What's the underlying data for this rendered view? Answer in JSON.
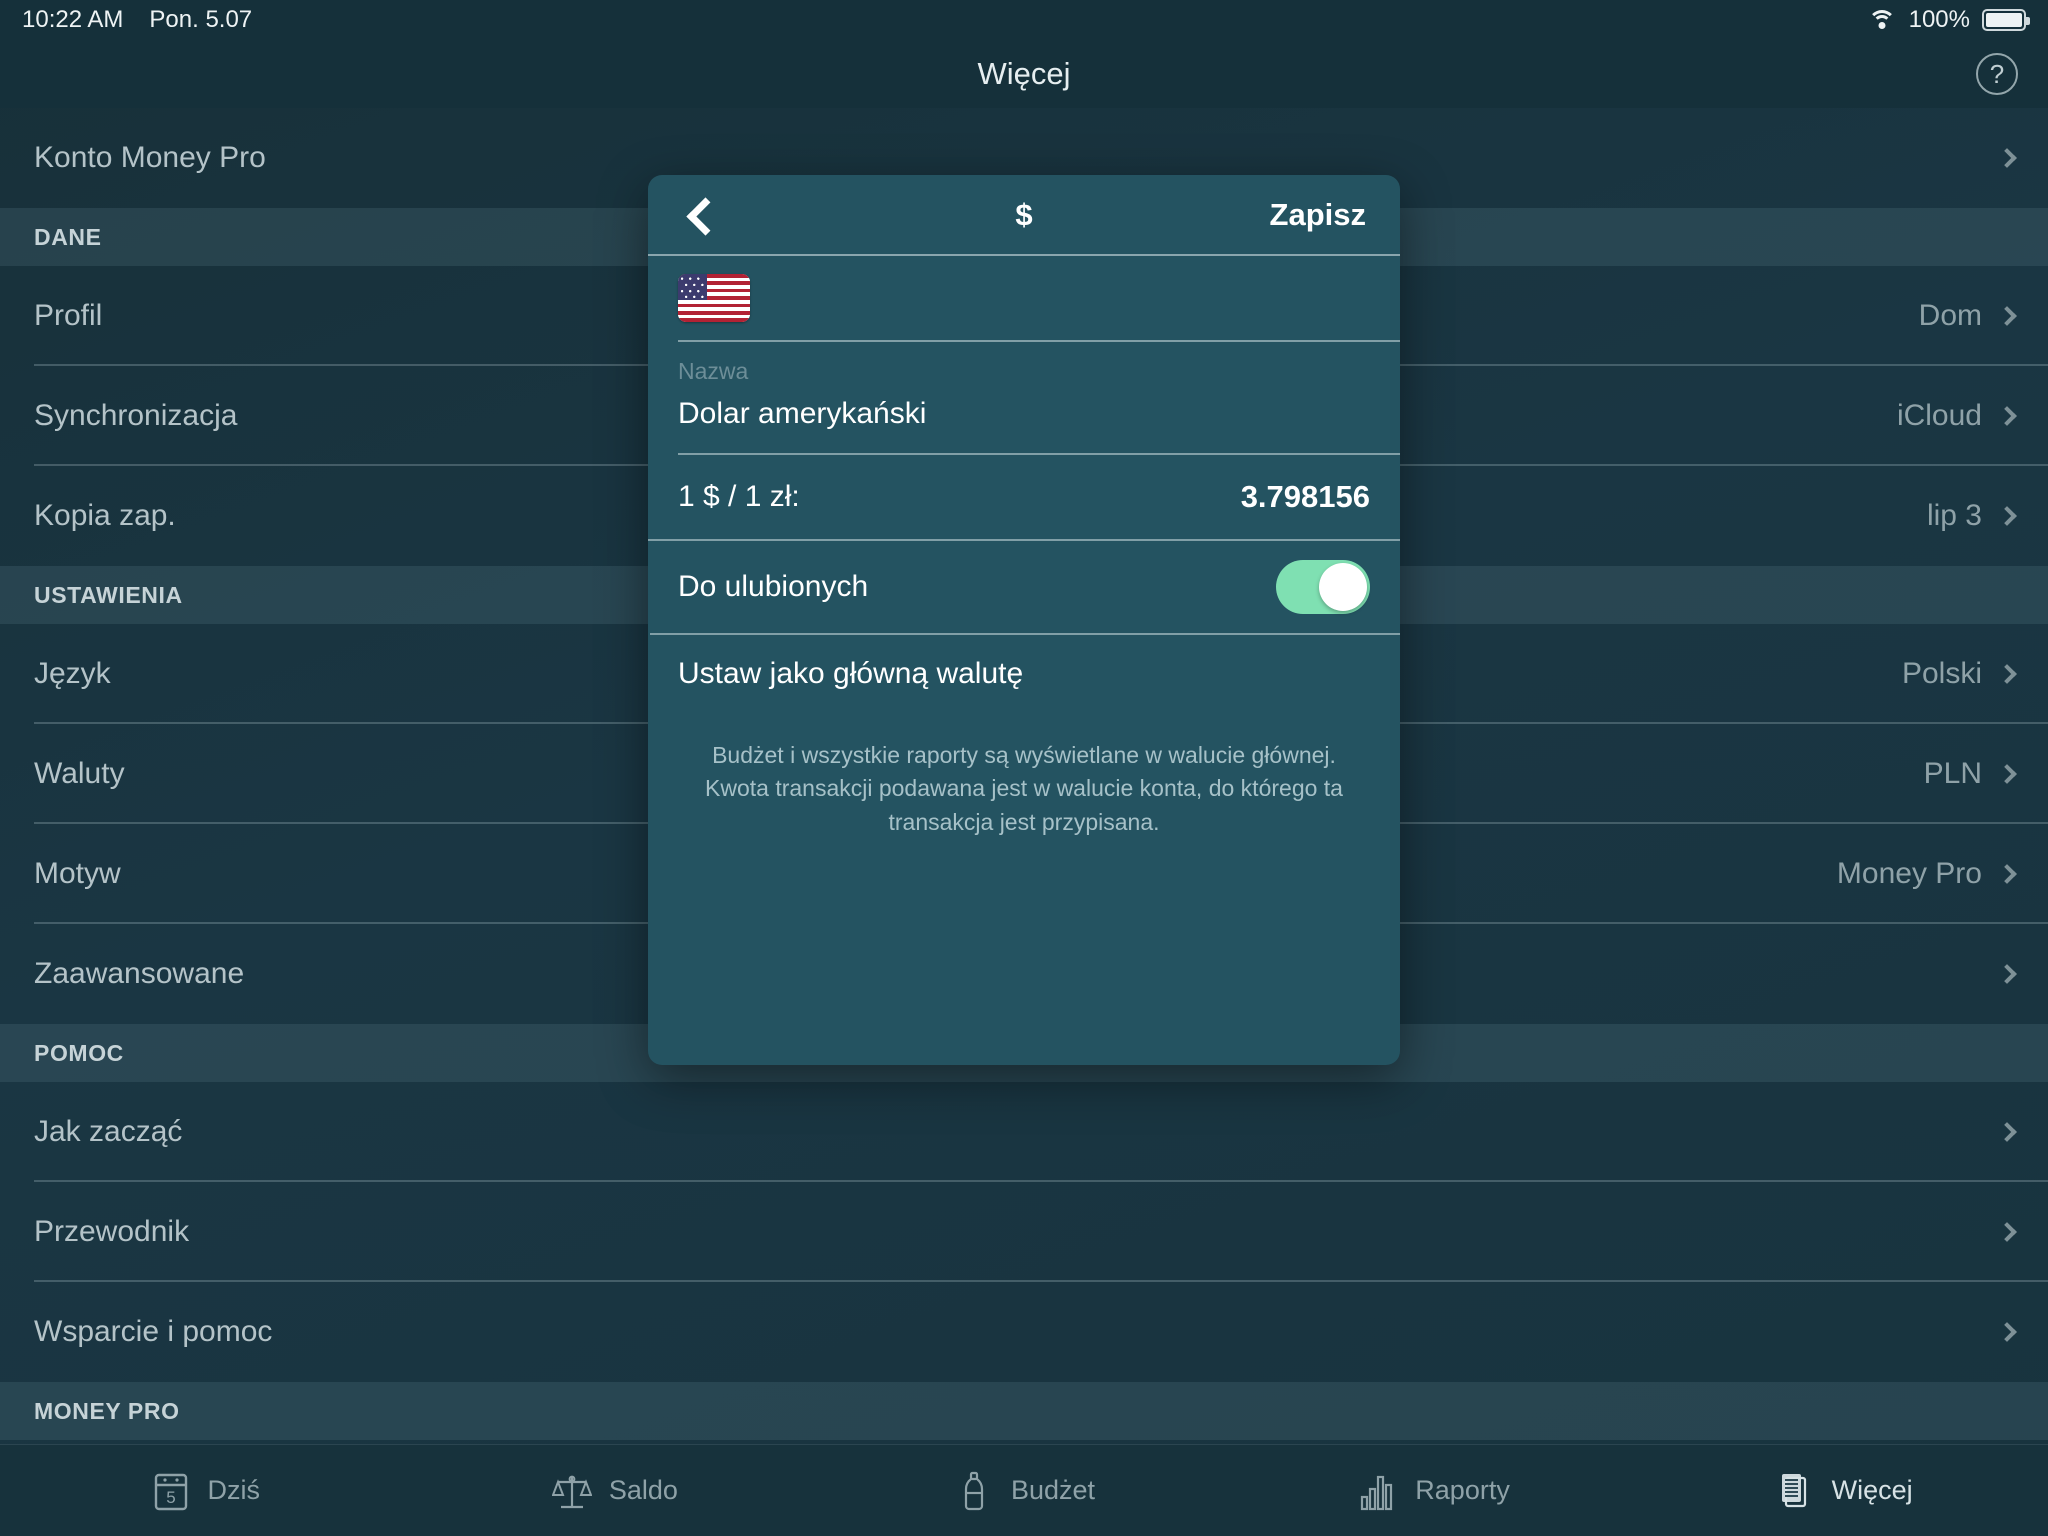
{
  "status_bar": {
    "time": "10:22 AM",
    "date": "Pon. 5.07",
    "wifi_icon": "wifi-icon",
    "battery_percent": "100%",
    "battery_icon": "battery-full-icon"
  },
  "navbar": {
    "title": "Więcej",
    "help_label": "?",
    "help_icon": "question-mark-circle-icon"
  },
  "settings_list": [
    {
      "kind": "row",
      "label": "Konto Money Pro",
      "value": "",
      "chevron": true
    },
    {
      "kind": "header",
      "label": "DANE"
    },
    {
      "kind": "row",
      "label": "Profil",
      "value": "Dom",
      "chevron": true
    },
    {
      "kind": "row",
      "label": "Synchronizacja",
      "value": "iCloud",
      "chevron": true
    },
    {
      "kind": "row",
      "label": "Kopia zap.",
      "value": "lip 3",
      "chevron": true
    },
    {
      "kind": "header",
      "label": "USTAWIENIA"
    },
    {
      "kind": "row",
      "label": "Język",
      "value": "Polski",
      "chevron": true
    },
    {
      "kind": "row",
      "label": "Waluty",
      "value": "PLN",
      "chevron": true
    },
    {
      "kind": "row",
      "label": "Motyw",
      "value": "Money Pro",
      "chevron": true
    },
    {
      "kind": "row",
      "label": "Zaawansowane",
      "value": "",
      "chevron": true
    },
    {
      "kind": "header",
      "label": "POMOC"
    },
    {
      "kind": "row",
      "label": "Jak zacząć",
      "value": "",
      "chevron": true
    },
    {
      "kind": "row",
      "label": "Przewodnik",
      "value": "",
      "chevron": true
    },
    {
      "kind": "row",
      "label": "Wsparcie i pomoc",
      "value": "",
      "chevron": true
    },
    {
      "kind": "header",
      "label": "MONEY PRO"
    }
  ],
  "popover": {
    "back_icon": "chevron-left-icon",
    "title": "$",
    "save_label": "Zapisz",
    "flag_icon": "flag-united-states-icon",
    "name_caption": "Nazwa",
    "name_value": "Dolar amerykański",
    "rate_label": "1 $ / 1 zł:",
    "rate_value": "3.798156",
    "favorite_label": "Do ulubionych",
    "favorite_on": true,
    "set_main_currency_label": "Ustaw jako główną walutę",
    "footer_note": "Budżet i wszystkie raporty są wyświetlane w walucie głównej. Kwota transakcji podawana jest w walucie konta, do którego ta transakcja jest przypisana."
  },
  "tabbar": {
    "items": [
      {
        "label": "Dziś",
        "icon": "calendar-icon",
        "active": false
      },
      {
        "label": "Saldo",
        "icon": "scales-icon",
        "active": false
      },
      {
        "label": "Budżet",
        "icon": "bottle-icon",
        "active": false
      },
      {
        "label": "Raporty",
        "icon": "bar-chart-icon",
        "active": false
      },
      {
        "label": "Więcej",
        "icon": "documents-icon",
        "active": true
      }
    ]
  },
  "colors": {
    "background": "#17323c",
    "popover_bg": "#245361",
    "accent_green": "#7fe0b2",
    "text_primary": "#ffffff",
    "text_secondary": "#b4c3c8"
  }
}
